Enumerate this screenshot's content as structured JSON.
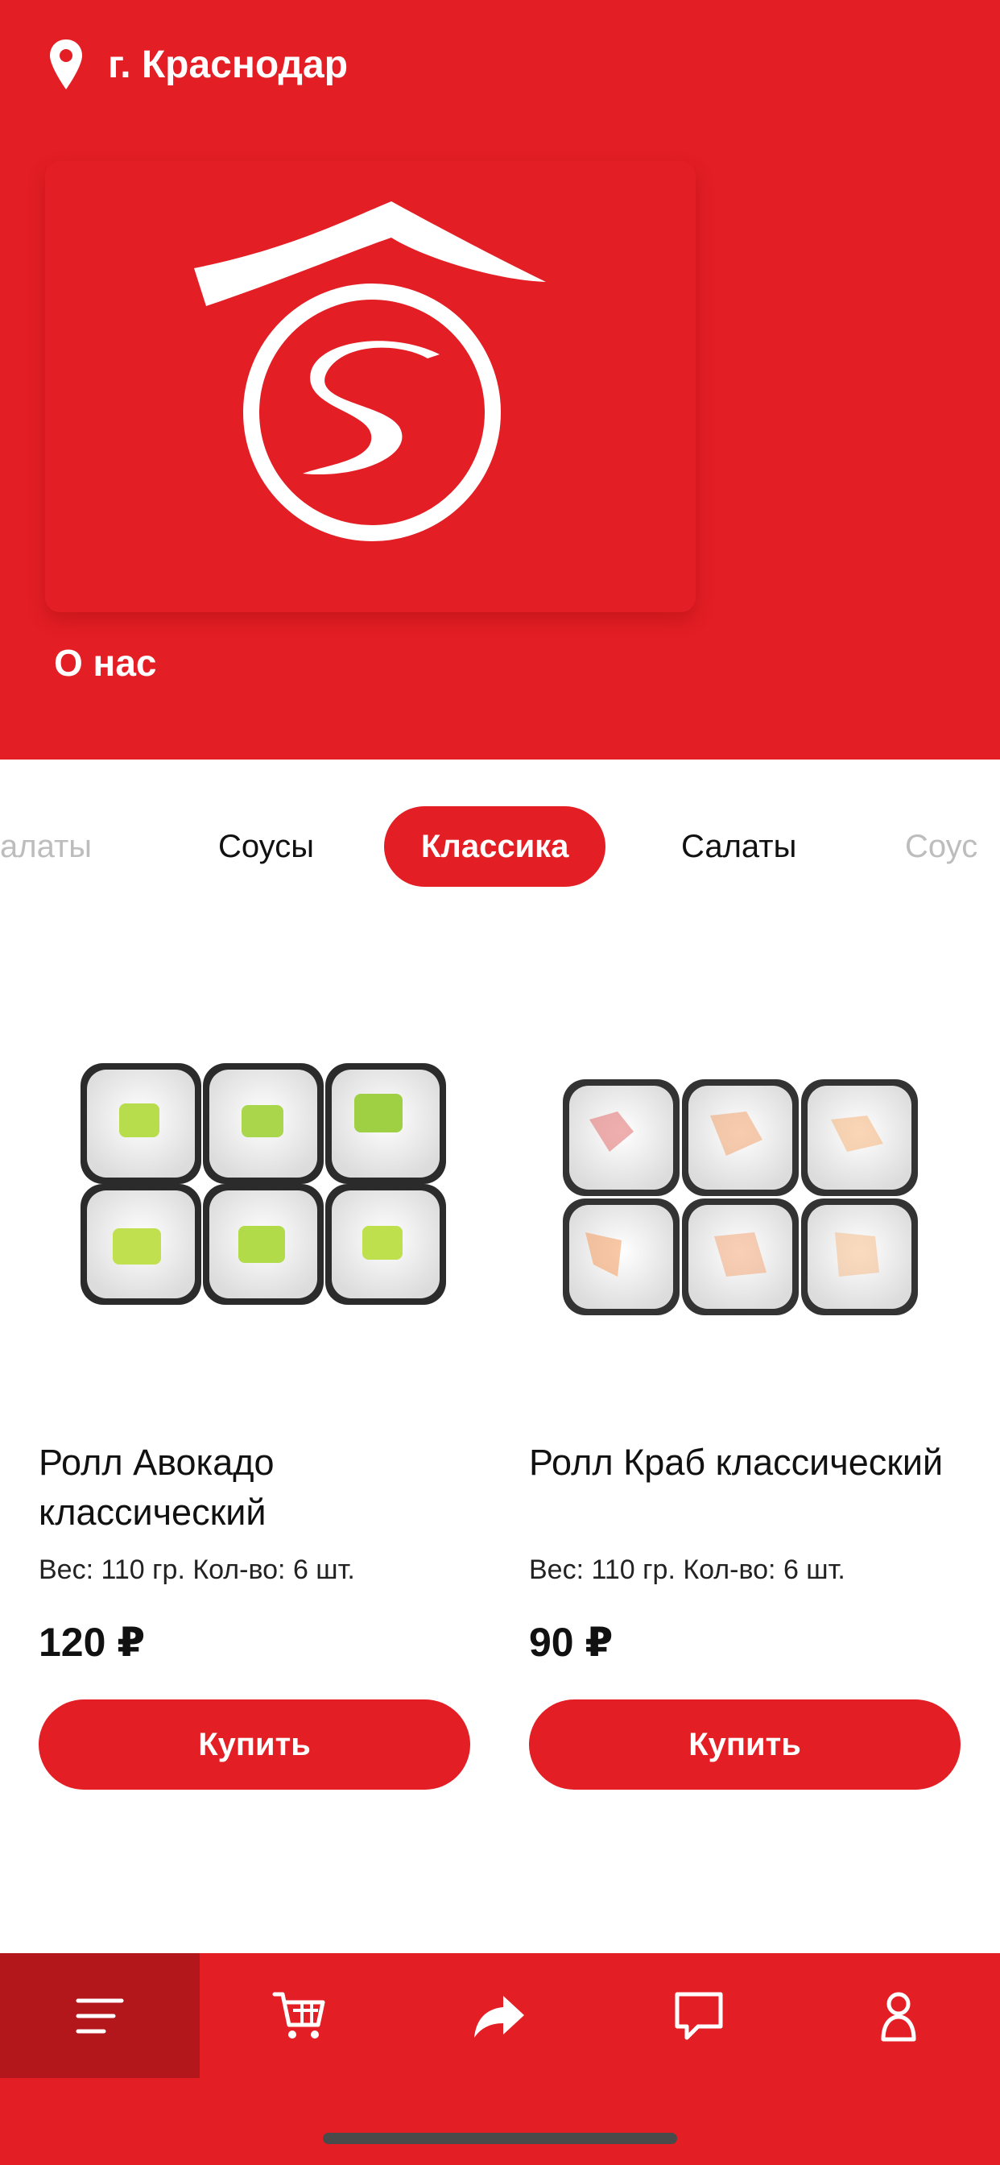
{
  "header": {
    "city": "г. Краснодар",
    "location_icon": "location-pin-icon"
  },
  "hero": {
    "logo": "sushi-logo",
    "about_label": "О нас"
  },
  "categories": {
    "items": [
      "алаты",
      "Соусы",
      "Классика",
      "Салаты",
      "Соус"
    ],
    "active": "Классика"
  },
  "products": [
    {
      "name": "Ролл Авокадо классический",
      "meta": "Вес: 110 гр. Кол-во: 6 шт.",
      "price": "120 ₽",
      "buy_label": "Купить"
    },
    {
      "name": "Ролл Краб классический",
      "meta": "Вес: 110 гр. Кол-во: 6 шт.",
      "price": "90 ₽",
      "buy_label": "Купить"
    }
  ],
  "bottom_nav": {
    "items": [
      {
        "icon": "menu-icon",
        "active": true
      },
      {
        "icon": "cart-icon",
        "active": false
      },
      {
        "icon": "share-icon",
        "active": false
      },
      {
        "icon": "chat-icon",
        "active": false
      },
      {
        "icon": "profile-icon",
        "active": false
      }
    ]
  },
  "colors": {
    "brand_red": "#e31e24",
    "active_nav": "#b3161b"
  }
}
